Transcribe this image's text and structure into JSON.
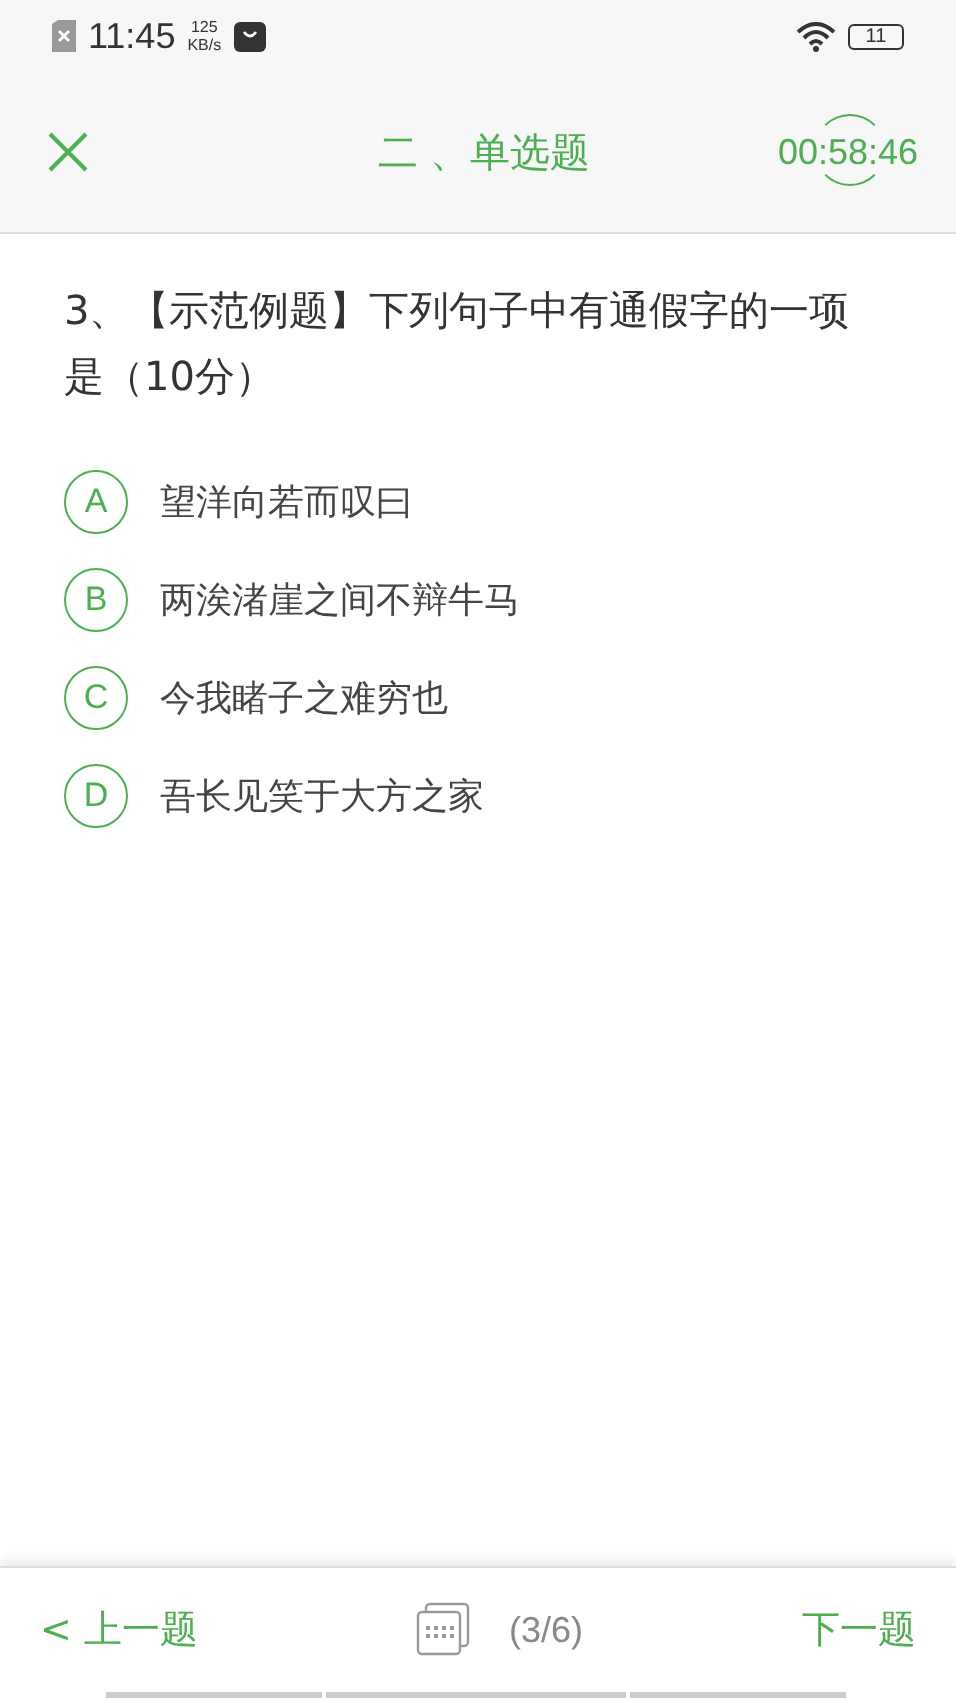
{
  "status_bar": {
    "time": "11:45",
    "speed_value": "125",
    "speed_unit": "KB/s",
    "battery": "11"
  },
  "header": {
    "title": "二 、单选题",
    "timer": "00:58:46"
  },
  "question": {
    "text": "3、【示范例题】下列句子中有通假字的一项是（10分）"
  },
  "options": [
    {
      "letter": "A",
      "text": "望洋向若而叹曰",
      "selected": false
    },
    {
      "letter": "B",
      "text": "两涘渚崖之间不辩牛马",
      "selected": false
    },
    {
      "letter": "C",
      "text": "今我睹子之难穷也",
      "selected": false
    },
    {
      "letter": "D",
      "text": "吾长见笑于大方之家",
      "selected": false
    }
  ],
  "footer": {
    "prev": "< 上一题",
    "progress": "(3/6)",
    "next": "下一题"
  }
}
